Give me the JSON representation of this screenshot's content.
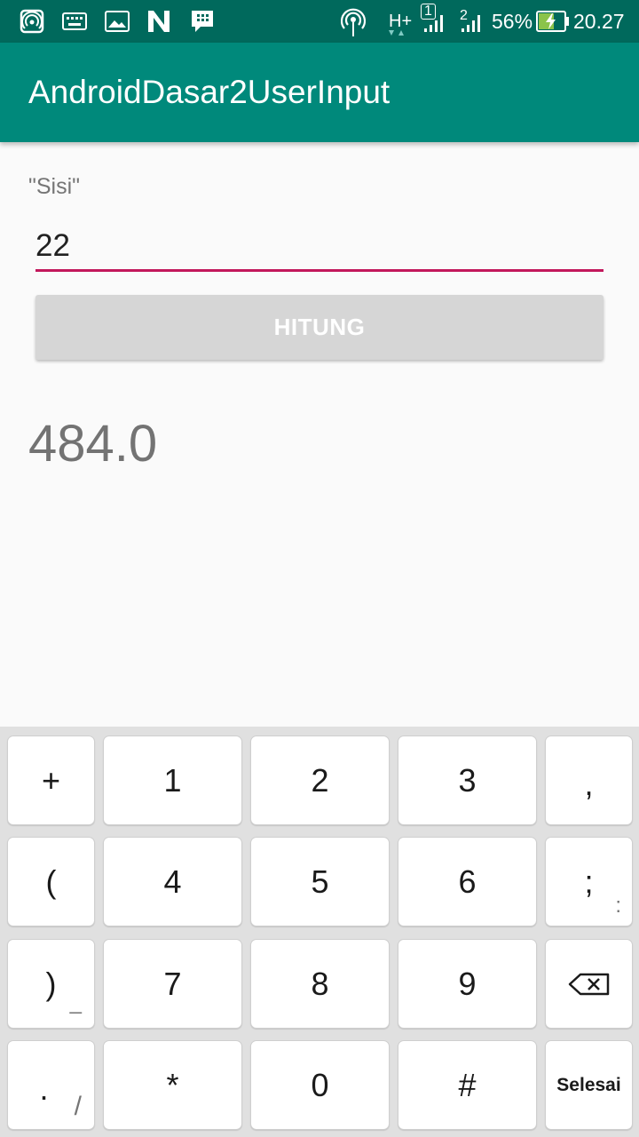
{
  "status_bar": {
    "signal_type": "H+",
    "sim1_label": "1",
    "sim2_label": "2",
    "battery_percent": "56%",
    "time": "20.27",
    "icons": [
      "hotspot-icon",
      "keyboard-icon",
      "image-icon",
      "n-app-icon",
      "bbm-icon",
      "wifi-icon",
      "signal-icon",
      "battery-charging-icon"
    ]
  },
  "app_bar": {
    "title": "AndroidDasar2UserInput"
  },
  "form": {
    "label": "\"Sisi\"",
    "input_value": "22",
    "button_label": "HITUNG"
  },
  "result": {
    "value": "484.0"
  },
  "keyboard": {
    "rows": [
      [
        {
          "main": "+"
        },
        {
          "main": "1"
        },
        {
          "main": "2"
        },
        {
          "main": "3"
        },
        {
          "main": ","
        }
      ],
      [
        {
          "main": "("
        },
        {
          "main": "4"
        },
        {
          "main": "5"
        },
        {
          "main": "6"
        },
        {
          "main": ";",
          "sub": ":"
        }
      ],
      [
        {
          "main": ")",
          "sub": "_"
        },
        {
          "main": "7"
        },
        {
          "main": "8"
        },
        {
          "main": "9"
        },
        {
          "icon": "backspace-icon"
        }
      ],
      [
        {
          "main": ".",
          "sub": "/"
        },
        {
          "main": "*"
        },
        {
          "main": "0"
        },
        {
          "main": "#"
        },
        {
          "main": "Selesai"
        }
      ]
    ]
  },
  "colors": {
    "status_bar": "#00695c",
    "app_bar": "#00897b",
    "input_underline": "#c2185b",
    "button_bg": "#d6d6d6"
  }
}
